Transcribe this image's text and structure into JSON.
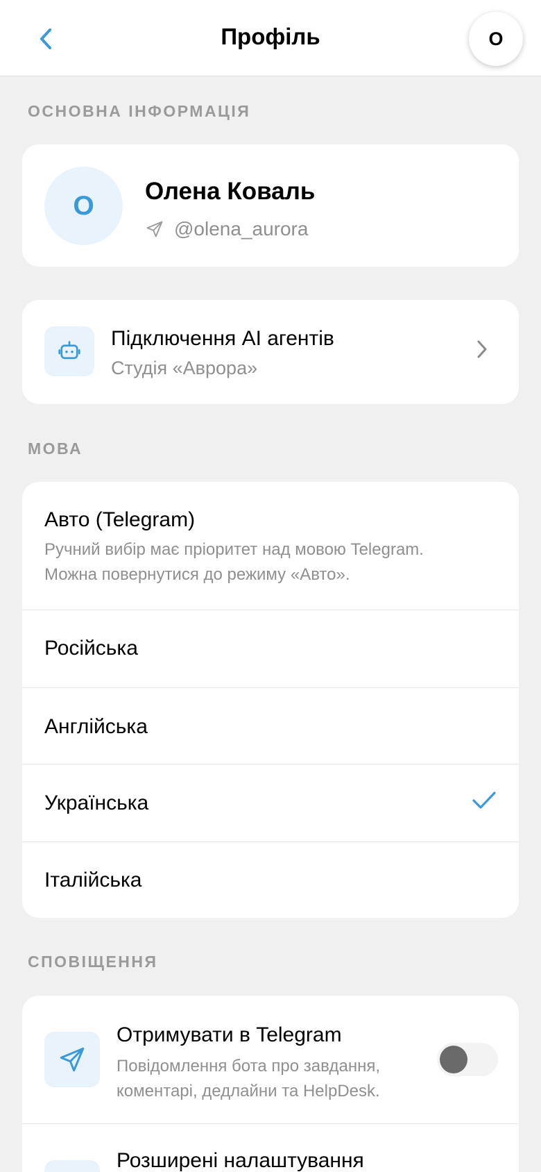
{
  "header": {
    "title": "Профіль",
    "avatar_initial": "O",
    "back_icon": "chevron-left-icon"
  },
  "sections": {
    "basic": "ОСНОВНА ІНФОРМАЦІЯ",
    "language": "МОВА",
    "notifications": "СПОВІЩЕННЯ"
  },
  "profile": {
    "initial": "O",
    "name": "Олена Коваль",
    "handle": "@olena_aurora",
    "handle_icon": "telegram-send-icon"
  },
  "agents": {
    "title": "Підключення AI агентів",
    "subtitle": "Студія «Аврора»",
    "icon": "robot-icon"
  },
  "language": {
    "auto_label": "Авто (Telegram)",
    "auto_hint_line1": "Ручний вибір має пріоритет над мовою Telegram.",
    "auto_hint_line2": "Можна повернутися до режиму «Авто».",
    "options": [
      {
        "label": "Російська",
        "selected": false
      },
      {
        "label": "Англійська",
        "selected": false
      },
      {
        "label": "Українська",
        "selected": true
      },
      {
        "label": "Італійська",
        "selected": false
      }
    ]
  },
  "notifications": {
    "telegram_title": "Отримувати в Telegram",
    "telegram_desc_line1": "Повідомлення бота про завдання,",
    "telegram_desc_line2": "коментарі, дедлайни та HelpDesk.",
    "telegram_enabled": false,
    "advanced_title": "Розширені налаштування"
  },
  "colors": {
    "accent": "#3a9ad9",
    "background": "#f0f0f0",
    "card": "#ffffff",
    "secondary_text": "#8f8f8f",
    "icon_bg": "#e9f3fb"
  }
}
